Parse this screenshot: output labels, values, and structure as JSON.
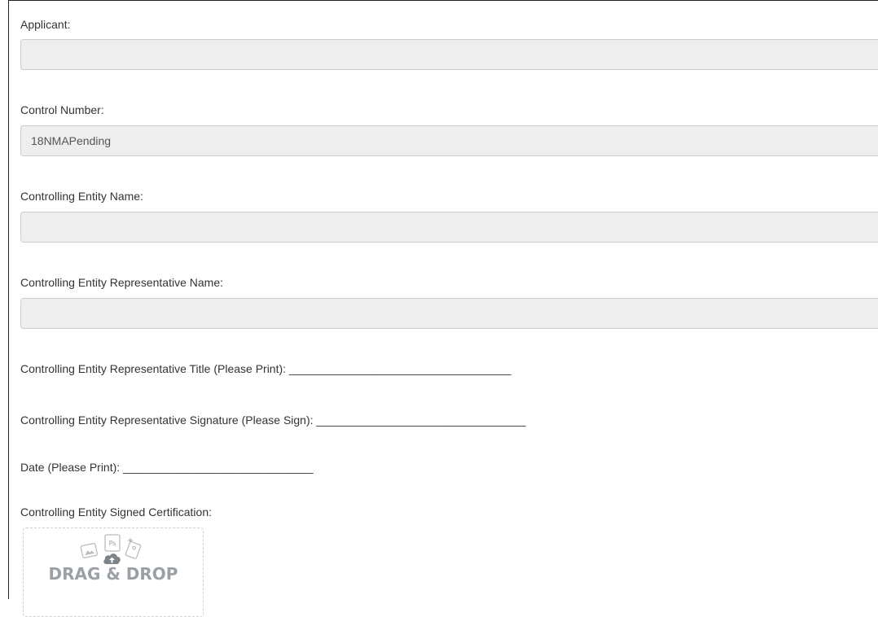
{
  "form": {
    "applicant": {
      "label": "Applicant:",
      "value": ""
    },
    "control_number": {
      "label": "Control Number:",
      "value": "18NMAPending"
    },
    "controlling_entity_name": {
      "label": "Controlling Entity Name:",
      "value": ""
    },
    "representative_name": {
      "label": "Controlling Entity Representative Name:",
      "value": ""
    },
    "representative_title_line": "Controlling Entity Representative Title (Please Print): ___________________________________",
    "representative_signature_line": "Controlling Entity Representative Signature (Please Sign): _________________________________",
    "date_line": "Date (Please Print): ______________________________",
    "signed_certification": {
      "label": "Controlling Entity Signed Certification:",
      "dropzone_text": "DRAG & DROP",
      "dropzone_icon_badge": "Ps"
    }
  }
}
